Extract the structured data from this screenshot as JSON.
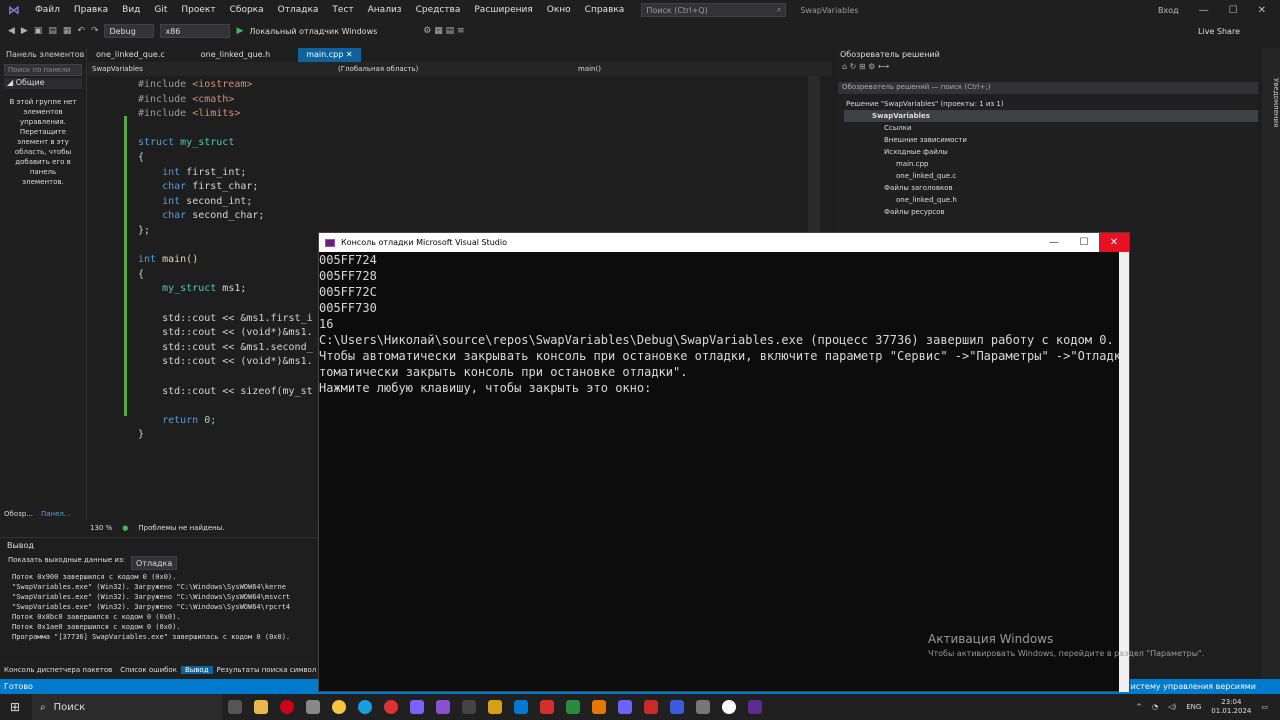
{
  "menubar": {
    "items": [
      "Файл",
      "Правка",
      "Вид",
      "Git",
      "Проект",
      "Сборка",
      "Отладка",
      "Тест",
      "Анализ",
      "Средства",
      "Расширения",
      "Окно",
      "Справка"
    ],
    "search_placeholder": "Поиск (Ctrl+Q)",
    "solution_title": "SwapVariables",
    "account": "Вход"
  },
  "toolbar": {
    "config": "Debug",
    "platform": "x86",
    "run_label": "Локальный отладчик Windows",
    "live_share": "Live Share"
  },
  "left_panel": {
    "title": "Панель элементов",
    "search_placeholder": "Поиск по панели",
    "group": "Общие",
    "empty_text": "В этой группе нет элементов управления. Перетащите элемент в эту область, чтобы добавить его в панель элементов.",
    "bottom_tabs": [
      "Обозр...",
      "Панел..."
    ]
  },
  "editor": {
    "tabs": [
      "one_linked_que.c",
      "one_linked_que.h",
      "main.cpp"
    ],
    "nav_project": "SwapVariables",
    "nav_scope": "(Глобальная область)",
    "nav_member": "main()",
    "zoom": "130 %",
    "problems": "Проблемы не найдены."
  },
  "code_lines": [
    {
      "a": "#include ",
      "b": "<iostream>"
    },
    {
      "a": "#include ",
      "b": "<cmath>"
    },
    {
      "a": "#include ",
      "b": "<limits>"
    },
    {
      "a": "",
      "b": ""
    },
    {
      "a": "struct ",
      "b": "my_struct"
    },
    {
      "a": "{",
      "b": ""
    },
    {
      "a": "    int ",
      "b": "first_int;"
    },
    {
      "a": "    char ",
      "b": "first_char;"
    },
    {
      "a": "    int ",
      "b": "second_int;"
    },
    {
      "a": "    char ",
      "b": "second_char;"
    },
    {
      "a": "};",
      "b": ""
    },
    {
      "a": "",
      "b": ""
    },
    {
      "a": "int ",
      "b": "main()"
    },
    {
      "a": "{",
      "b": ""
    },
    {
      "a": "    my_struct ",
      "b": "ms1;"
    },
    {
      "a": "",
      "b": ""
    },
    {
      "a": "    std::cout ",
      "b": "<< &ms1.first_i"
    },
    {
      "a": "    std::cout ",
      "b": "<< (void*)&ms1."
    },
    {
      "a": "    std::cout ",
      "b": "<< &ms1.second_"
    },
    {
      "a": "    std::cout ",
      "b": "<< (void*)&ms1."
    },
    {
      "a": "",
      "b": ""
    },
    {
      "a": "    std::cout ",
      "b": "<< sizeof(my_st"
    },
    {
      "a": "",
      "b": ""
    },
    {
      "a": "    return ",
      "b": "0;"
    },
    {
      "a": "}",
      "b": ""
    }
  ],
  "output": {
    "title": "Вывод",
    "source_label": "Показать выходные данные из:",
    "source_value": "Отладка",
    "lines": [
      "Поток 0x900 завершился с кодом 0 (0x0).",
      "\"SwapVariables.exe\" (Win32). Загружено \"C:\\Windows\\SysWOW64\\kerne",
      "\"SwapVariables.exe\" (Win32). Загружено \"C:\\Windows\\SysWOW64\\msvcrt",
      "\"SwapVariables.exe\" (Win32). Загружено \"C:\\Windows\\SysWOW64\\rpcrt4",
      "Поток 0x8bc0 завершился с кодом 0 (0x0).",
      "Поток 0x1ae0 завершился с кодом 0 (0x0).",
      "Программа \"[37736] SwapVariables.exe\" завершилась с кодом 0 (0x0)."
    ],
    "bottom_tabs": [
      "Консоль диспетчера пакетов",
      "Список ошибок",
      "Вывод",
      "Результаты поиска символ"
    ]
  },
  "status": {
    "ready": "Готово",
    "right": "Добавить в систему управления версиями"
  },
  "solution_explorer": {
    "title": "Обозреватель решений",
    "search_placeholder": "Обозреватель решений — поиск (Ctrl+;)",
    "solution": "Решение \"SwapVariables\" (проекты: 1 из 1)",
    "project": "SwapVariables",
    "items": [
      "Ссылки",
      "Внешние зависимости",
      "Исходные файлы",
      "main.cpp",
      "one_linked_que.c",
      "Файлы заголовков",
      "one_linked_que.h",
      "Файлы ресурсов"
    ]
  },
  "right_rail": "Уведомления",
  "console": {
    "title": "Консоль отладки Microsoft Visual Studio",
    "lines": [
      "005FF724",
      "005FF728",
      "005FF72C",
      "005FF730",
      "16",
      "C:\\Users\\Николай\\source\\repos\\SwapVariables\\Debug\\SwapVariables.exe (процесс 37736) завершил работу с кодом 0.",
      "Чтобы автоматически закрывать консоль при остановке отладки, включите параметр \"Сервис\" ->\"Параметры\" ->\"Отладка\" -> \"Ав",
      "томатически закрыть консоль при остановке отладки\".",
      "Нажмите любую клавишу, чтобы закрыть это окно:"
    ]
  },
  "activation": {
    "title": "Активация Windows",
    "subtitle": "Чтобы активировать Windows, перейдите в раздел \"Параметры\"."
  },
  "taskbar": {
    "search": "Поиск",
    "lang": "ENG",
    "time": "23:04",
    "date": "01.01.2024"
  },
  "colors": {
    "accent": "#007acc",
    "close": "#e81123",
    "vs_purple": "#68217a"
  }
}
